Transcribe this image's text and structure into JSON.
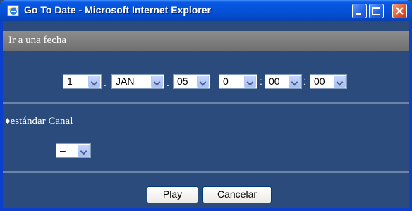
{
  "window": {
    "title": "Go To Date - Microsoft Internet Explorer"
  },
  "section": {
    "title": "Ir a una fecha"
  },
  "date": {
    "day": "1",
    "month": "JAN",
    "year": "05",
    "hour": "0",
    "minute": "00",
    "second": "00",
    "sep_dot": ".",
    "sep_colon": ":"
  },
  "channel": {
    "label": "♦estándar Canal",
    "value": "–"
  },
  "buttons": {
    "play": "Play",
    "cancel": "Cancelar"
  },
  "icons": [
    "ie-icon",
    "minimize-icon",
    "maximize-icon",
    "close-icon",
    "chevron-down-icon"
  ],
  "colors": {
    "titlebar": "#0552d8",
    "background": "#2b4b7c",
    "section_header": "#7c7c7c"
  }
}
